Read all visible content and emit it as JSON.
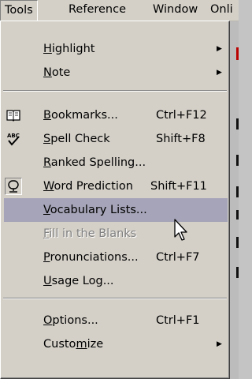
{
  "menubar": {
    "tools": "Tools",
    "reference": "Reference",
    "window": "Window",
    "online": "Onli"
  },
  "menu": {
    "highlight": {
      "label": "Highlight",
      "mnemonic": "H",
      "rest": "ighlight"
    },
    "note": {
      "label": "Note",
      "mnemonic": "N",
      "rest": "ote"
    },
    "bookmarks": {
      "label": "Bookmarks...",
      "mnemonic": "B",
      "rest": "ookmarks...",
      "shortcut": "Ctrl+F12",
      "icon": "book-icon"
    },
    "spell_check": {
      "label": "Spell Check",
      "mnemonic": "S",
      "rest": "pell Check",
      "shortcut": "Shift+F8",
      "icon": "spellcheck-icon"
    },
    "ranked_spelling": {
      "label": "Ranked Spelling...",
      "mnemonic": "R",
      "rest": "anked Spelling..."
    },
    "word_prediction": {
      "label": "Word Prediction",
      "mnemonic": "W",
      "rest": "ord Prediction",
      "shortcut": "Shift+F11",
      "icon": "word-prediction-icon",
      "checked": true
    },
    "vocabulary_lists": {
      "label": "Vocabulary Lists...",
      "mnemonic": "V",
      "rest": "ocabulary Lists...",
      "highlighted": true
    },
    "fill_blanks": {
      "label": "Fill in the Blanks",
      "mnemonic": "F",
      "rest": "ill in the Blanks",
      "enabled": false
    },
    "pronunciations": {
      "label": "Pronunciations...",
      "mnemonic": "P",
      "rest": "ronunciations...",
      "shortcut": "Ctrl+F7"
    },
    "usage_log": {
      "label": "Usage Log...",
      "mnemonic": "U",
      "rest": "sage Log..."
    },
    "options": {
      "label": "Options...",
      "mnemonic": "O",
      "rest": "ptions...",
      "shortcut": "Ctrl+F1"
    },
    "customize": {
      "label": "Customize",
      "pre": "Custo",
      "mnemonic": "m",
      "rest": "ize"
    }
  },
  "colors": {
    "menu_bg": "#d4d0c8",
    "highlight": "#a5a4b8",
    "disabled_text": "#808080"
  }
}
